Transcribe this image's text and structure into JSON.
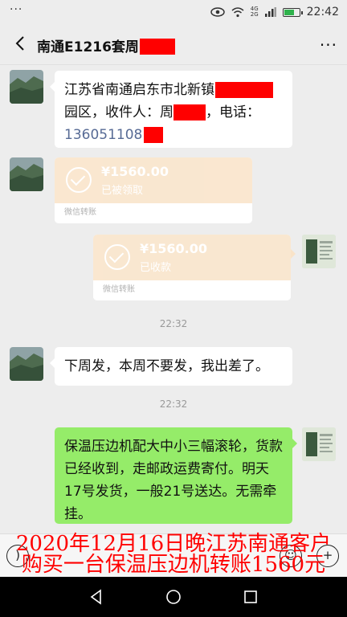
{
  "status_bar": {
    "dots": "···",
    "network_top": "4G",
    "network_bottom": "2G",
    "time": "22:42"
  },
  "header": {
    "title": "南通E1216套周",
    "more": "···"
  },
  "messages": {
    "m1": {
      "line1": "江苏省南通启东市北新镇",
      "line2a": "园区，收件人：周",
      "line2b": "，电话：",
      "phone": "136051108"
    },
    "transfer1": {
      "amount": "¥1560.00",
      "status": "已被领取",
      "label": "微信转账"
    },
    "transfer2": {
      "amount": "¥1560.00",
      "status": "已收款",
      "label": "微信转账"
    },
    "time1": "22:32",
    "m2": {
      "text": "下周发，本周不要发，我出差了。"
    },
    "time2": "22:32",
    "m3": {
      "text": "保温压边机配大中小三幅滚轮，货款已经收到，走邮政运费寄付。明天17号发货，一般21号送达。无需牵挂。"
    }
  },
  "caption": {
    "line1": "2020年12月16日晚江苏南通客户",
    "line2": "购买一台保温压边机转账1560元"
  },
  "colors": {
    "bubble_green": "#95ec69",
    "transfer_orange": "#f9e3c8",
    "redaction": "#ff0000",
    "caption": "#ff0000",
    "link": "#576b95"
  }
}
